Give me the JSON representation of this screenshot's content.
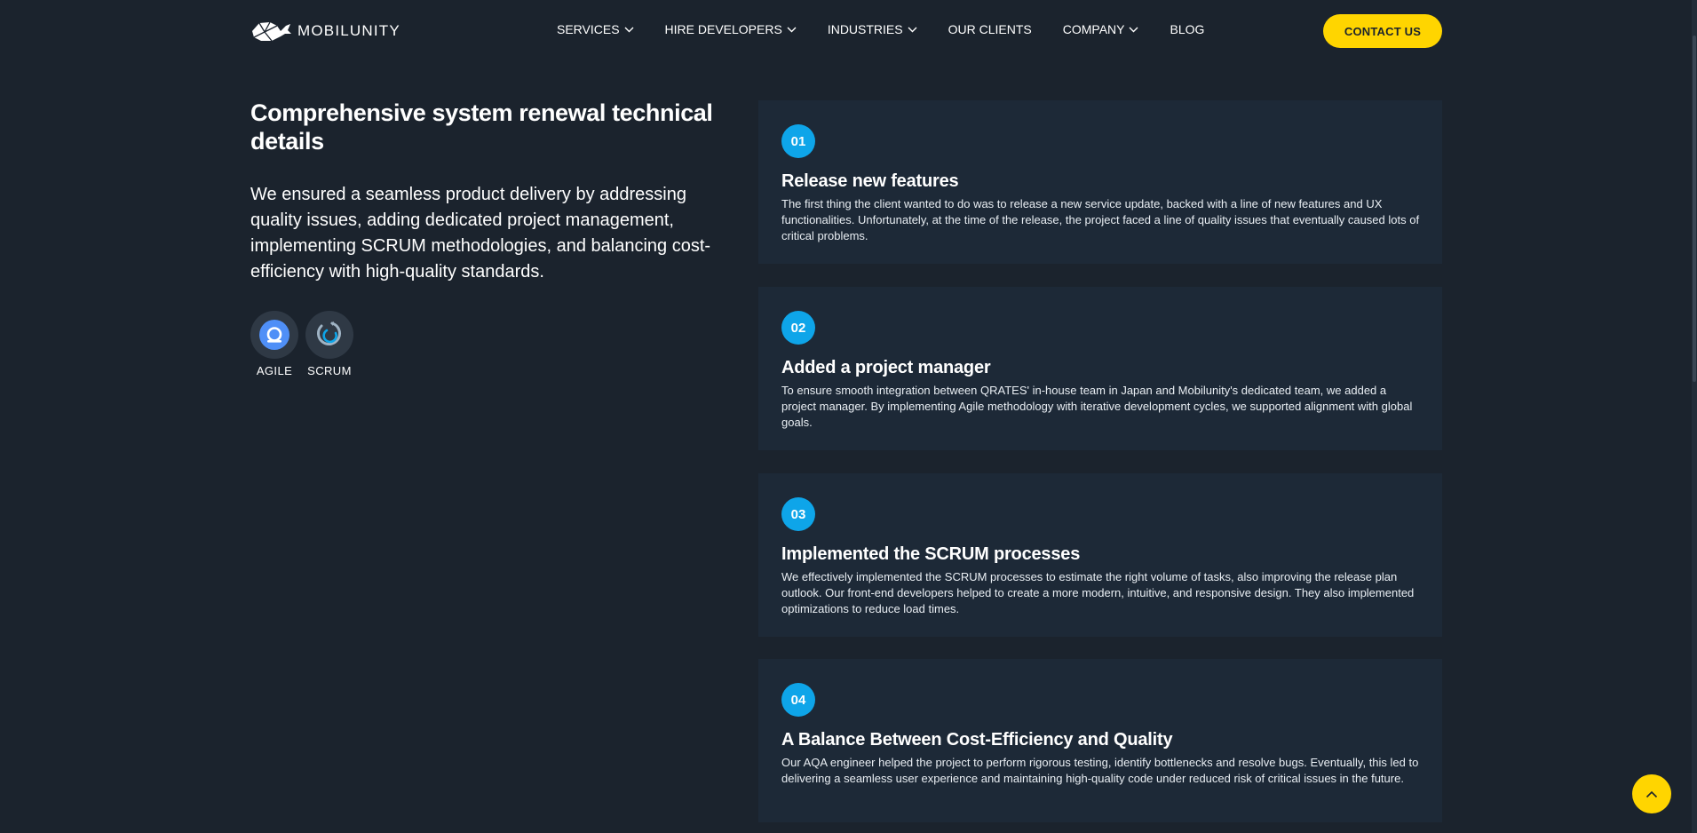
{
  "brand": {
    "name": "MOBILUNITY"
  },
  "nav": {
    "items": [
      {
        "label": "SERVICES",
        "has_dropdown": true
      },
      {
        "label": "HIRE DEVELOPERS",
        "has_dropdown": true
      },
      {
        "label": "INDUSTRIES",
        "has_dropdown": true
      },
      {
        "label": "OUR CLIENTS",
        "has_dropdown": false
      },
      {
        "label": "COMPANY",
        "has_dropdown": true
      },
      {
        "label": "BLOG",
        "has_dropdown": false
      }
    ],
    "contact_label": "CONTACT US"
  },
  "section": {
    "title": "Comprehensive system renewal technical details",
    "intro": "We ensured a seamless product delivery by addressing quality issues, adding dedicated project management, implementing SCRUM methodologies, and balancing cost-efficiency with high-quality standards.",
    "badges": [
      {
        "label": "AGILE",
        "icon": "agile-icon"
      },
      {
        "label": "SCRUM",
        "icon": "scrum-icon"
      }
    ]
  },
  "steps": [
    {
      "number": "01",
      "title": "Release new features",
      "text": "The first thing the client wanted to do was to release a new service update, backed with a line of new features and UX functionalities. Unfortunately, at the time of the release, the project faced a line of quality issues that eventually caused lots of critical problems."
    },
    {
      "number": "02",
      "title": "Added a project manager",
      "text": "To ensure smooth integration between QRATES' in-house team in Japan and Mobilunity's dedicated team, we added a project manager. By implementing Agile methodology with iterative development cycles, we supported alignment with global goals."
    },
    {
      "number": "03",
      "title": "Implemented the SCRUM processes",
      "text": "We effectively implemented the SCRUM processes to estimate the right volume of tasks, also improving the release plan outlook. Our front-end developers helped to create a more modern, intuitive, and responsive design. They also implemented optimizations to reduce load times."
    },
    {
      "number": "04",
      "title": "A Balance Between Cost-Efficiency and Quality",
      "text": "Our AQA engineer helped the project to perform rigorous testing, identify bottlenecks and resolve bugs. Eventually, this led to delivering a seamless user experience and maintaining high-quality code under reduced risk of critical issues in the future."
    }
  ],
  "colors": {
    "background": "#1b232d",
    "card": "#1d2937",
    "accent_yellow": "#ffd500",
    "accent_blue": "#0ea5e9"
  },
  "icons": {
    "logo": "whale-logo-icon",
    "dropdown": "chevron-down-icon",
    "scroll_top": "chevron-up-icon"
  }
}
